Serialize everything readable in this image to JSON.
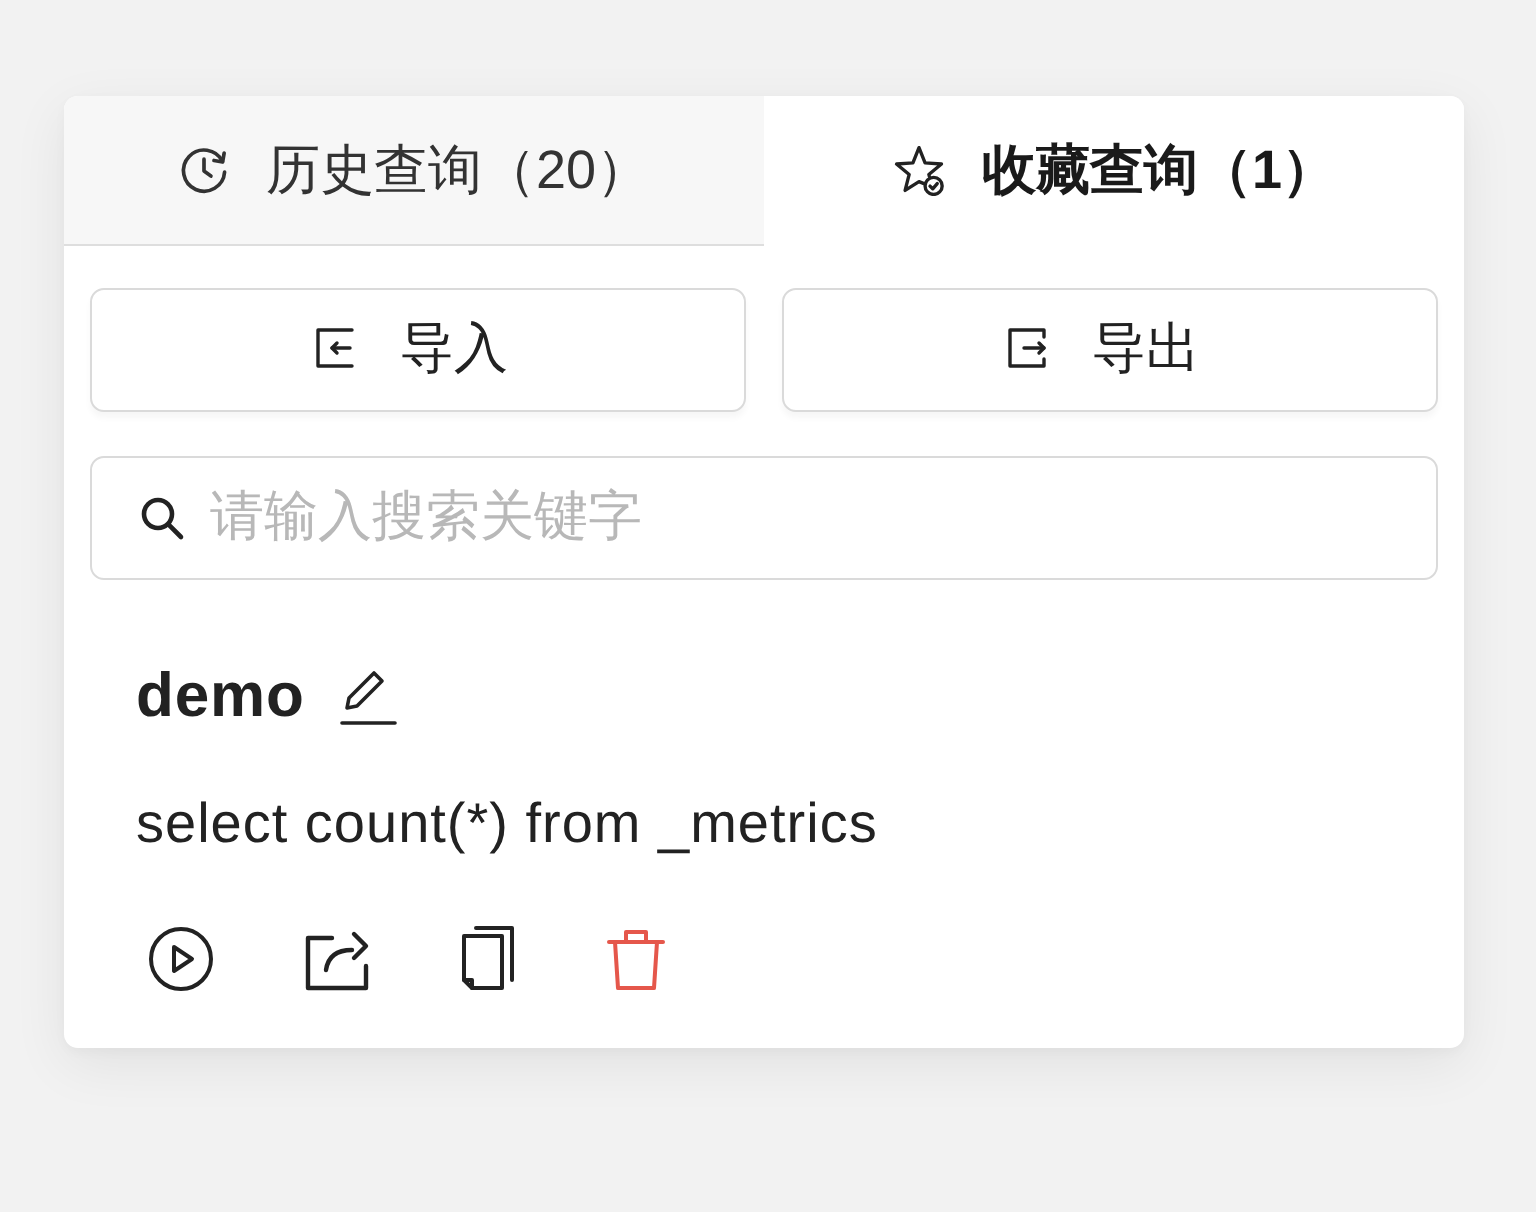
{
  "tabs": [
    {
      "label": "历史查询（20）",
      "kind": "history",
      "selected": false
    },
    {
      "label": "收藏查询（1）",
      "kind": "favorites",
      "selected": true
    }
  ],
  "buttons": [
    {
      "label": "导入",
      "kind": "import"
    },
    {
      "label": "导出",
      "kind": "export"
    }
  ],
  "search": {
    "placeholder": "请输入搜索关键字"
  },
  "favorites": [
    {
      "name": "demo",
      "query": "select count(*) from _metrics"
    }
  ]
}
